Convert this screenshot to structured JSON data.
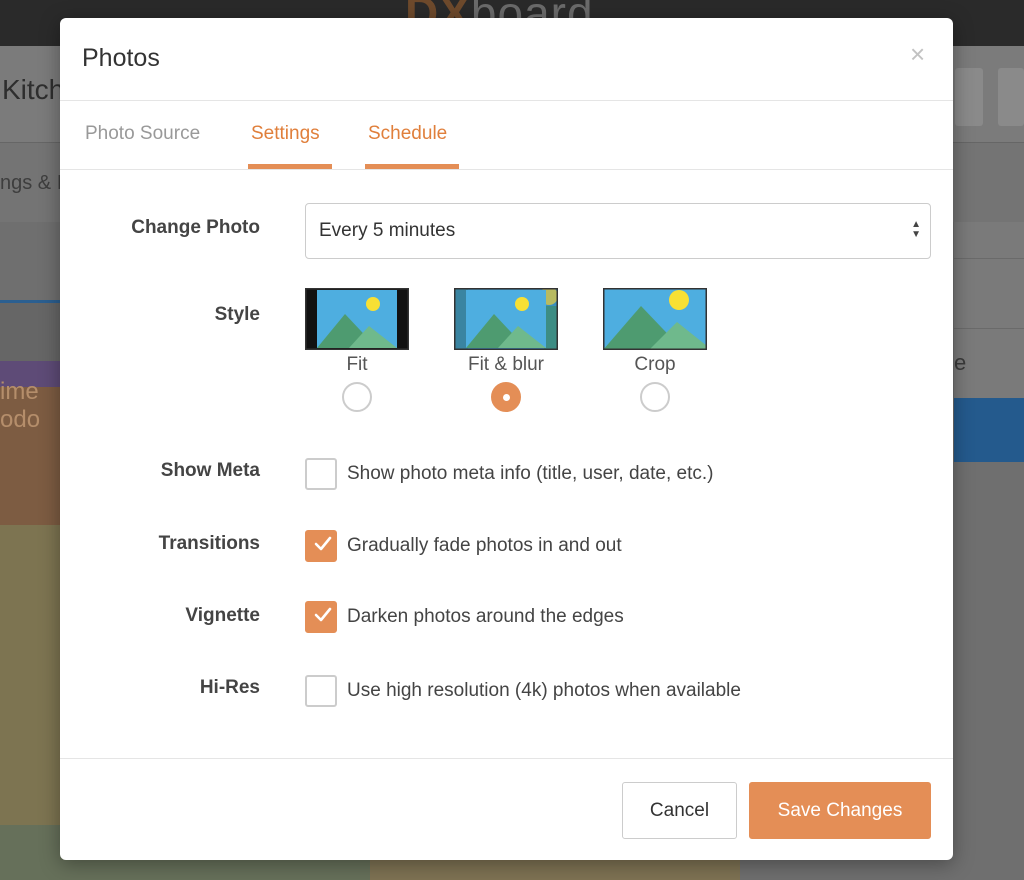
{
  "background": {
    "logo_bold": "DX",
    "logo_thin": "board",
    "page_title": "Kitch",
    "subbar_text": "ngs & I",
    "orange_text": "ime\nodo",
    "right_text": "e"
  },
  "modal": {
    "title": "Photos",
    "close_symbol": "×",
    "tabs": [
      {
        "label": "Photo Source",
        "active": false
      },
      {
        "label": "Settings",
        "active": true
      },
      {
        "label": "Schedule",
        "active": false
      }
    ],
    "change_photo": {
      "label": "Change Photo",
      "value": "Every 5 minutes",
      "arrows": "▲\n▼"
    },
    "style": {
      "label": "Style",
      "options": [
        {
          "label": "Fit",
          "selected": false
        },
        {
          "label": "Fit & blur",
          "selected": true
        },
        {
          "label": "Crop",
          "selected": false
        }
      ]
    },
    "checkbox_rows": [
      {
        "label": "Show Meta",
        "text": "Show photo meta info (title, user, date, etc.)",
        "checked": false
      },
      {
        "label": "Transitions",
        "text": "Gradually fade photos in and out",
        "checked": true
      },
      {
        "label": "Vignette",
        "text": "Darken photos around the edges",
        "checked": true
      },
      {
        "label": "Hi-Res",
        "text": "Use high resolution (4k) photos when available",
        "checked": false
      }
    ],
    "buttons": {
      "cancel": "Cancel",
      "save": "Save Changes"
    }
  },
  "colors": {
    "accent": "#e48e56",
    "tab_text_active": "#e07f3b",
    "annotation_arrow": "#e0442b",
    "sky": "#4eaee0",
    "mountain": "#4e9b70",
    "sun": "#f7e034"
  }
}
